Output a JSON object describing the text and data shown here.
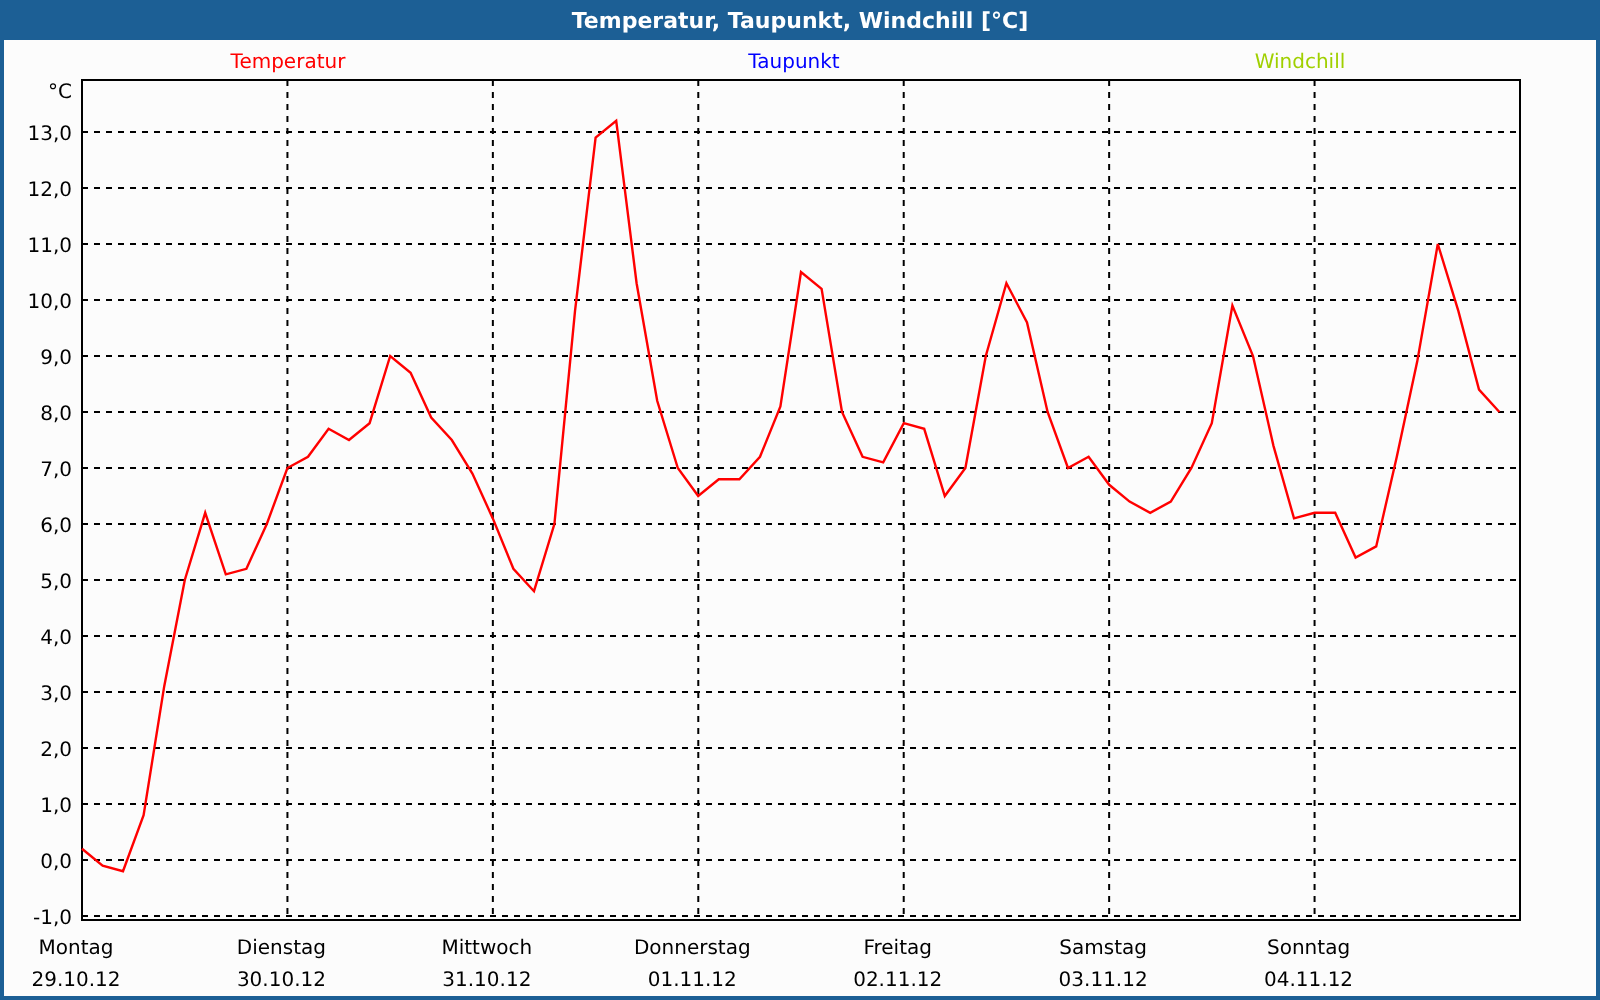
{
  "window": {
    "title": "Temperatur, Taupunkt, Windchill [°C]"
  },
  "chart": {
    "chart_data": {
      "type": "line",
      "grid": true,
      "ylabel": "°C",
      "ylim": [
        -1.07,
        13.93
      ],
      "yticks": [
        {
          "value": -1,
          "label": "-1,0"
        },
        {
          "value": 0,
          "label": "0,0"
        },
        {
          "value": 1,
          "label": "1,0"
        },
        {
          "value": 2,
          "label": "2,0"
        },
        {
          "value": 3,
          "label": "3,0"
        },
        {
          "value": 4,
          "label": "4,0"
        },
        {
          "value": 5,
          "label": "5,0"
        },
        {
          "value": 6,
          "label": "6,0"
        },
        {
          "value": 7,
          "label": "7,0"
        },
        {
          "value": 8,
          "label": "8,0"
        },
        {
          "value": 9,
          "label": "9,0"
        },
        {
          "value": 10,
          "label": "10,0"
        },
        {
          "value": 11,
          "label": "11,0"
        },
        {
          "value": 12,
          "label": "12,0"
        },
        {
          "value": 13,
          "label": "13,0"
        }
      ],
      "categories": [
        "Montag",
        null,
        null,
        null,
        null,
        null,
        null,
        null,
        null,
        null,
        "Dienstag",
        null,
        null,
        null,
        null,
        null,
        null,
        null,
        null,
        null,
        "Mittwoch",
        null,
        null,
        null,
        null,
        null,
        null,
        null,
        null,
        null,
        "Donnerstag",
        null,
        null,
        null,
        null,
        null,
        null,
        null,
        null,
        null,
        "Freitag",
        null,
        null,
        null,
        null,
        null,
        null,
        null,
        null,
        null,
        "Samstag",
        null,
        null,
        null,
        null,
        null,
        null,
        null,
        null,
        null,
        "Sonntag",
        null,
        null,
        null,
        null,
        null,
        null,
        null,
        null,
        null
      ],
      "series": [
        {
          "name": "Temperatur",
          "color": "#ff0000",
          "values": [
            0.2,
            -0.1,
            -0.2,
            0.8,
            3.1,
            5.0,
            6.2,
            5.1,
            5.2,
            6.0,
            7.0,
            7.2,
            7.7,
            7.5,
            7.8,
            9.0,
            8.7,
            7.9,
            7.5,
            6.9,
            6.1,
            5.2,
            4.8,
            6.0,
            9.8,
            12.9,
            13.2,
            10.3,
            8.2,
            7.0,
            6.5,
            6.8,
            6.8,
            7.2,
            8.1,
            10.5,
            10.2,
            8.0,
            7.2,
            7.1,
            7.8,
            7.7,
            6.5,
            7.0,
            9.0,
            10.3,
            9.6,
            8.0,
            7.0,
            7.2,
            6.7,
            6.4,
            6.2,
            6.4,
            7.0,
            7.8,
            9.9,
            9.0,
            7.4,
            6.1,
            6.2,
            6.2,
            5.4,
            5.6,
            7.2,
            8.9,
            11.0,
            9.8,
            8.4,
            8.0
          ]
        },
        {
          "name": "Taupunkt",
          "color": "#0000ff",
          "values": [
            null,
            null,
            null,
            null,
            null,
            null,
            null,
            null,
            null,
            null,
            null,
            null,
            null,
            null,
            null,
            null,
            null,
            null,
            null,
            null,
            null,
            null,
            null,
            null,
            null,
            null,
            null,
            null,
            null,
            null,
            null,
            null,
            null,
            null,
            null,
            null,
            null,
            null,
            null,
            null,
            null,
            null,
            null,
            null,
            null,
            null,
            null,
            null,
            null,
            null,
            null,
            null,
            null,
            null,
            null,
            null,
            null,
            null,
            null,
            null,
            null,
            null,
            null,
            null,
            null,
            null,
            null,
            null,
            null,
            null
          ]
        },
        {
          "name": "Windchill",
          "color": "#a0d000",
          "values": [
            null,
            null,
            null,
            null,
            null,
            null,
            null,
            null,
            null,
            null,
            null,
            null,
            null,
            null,
            null,
            null,
            null,
            null,
            null,
            null,
            null,
            null,
            null,
            null,
            null,
            null,
            null,
            null,
            null,
            null,
            null,
            null,
            null,
            null,
            null,
            null,
            null,
            null,
            null,
            null,
            null,
            null,
            null,
            null,
            null,
            null,
            null,
            null,
            null,
            null,
            null,
            null,
            null,
            null,
            null,
            null,
            null,
            null,
            null,
            null,
            null,
            null,
            null,
            null,
            null,
            null,
            null,
            null,
            null,
            null
          ]
        }
      ]
    },
    "x_dates": [
      "29.10.12",
      "30.10.12",
      "31.10.12",
      "01.11.12",
      "02.11.12",
      "03.11.12",
      "04.11.12"
    ]
  }
}
